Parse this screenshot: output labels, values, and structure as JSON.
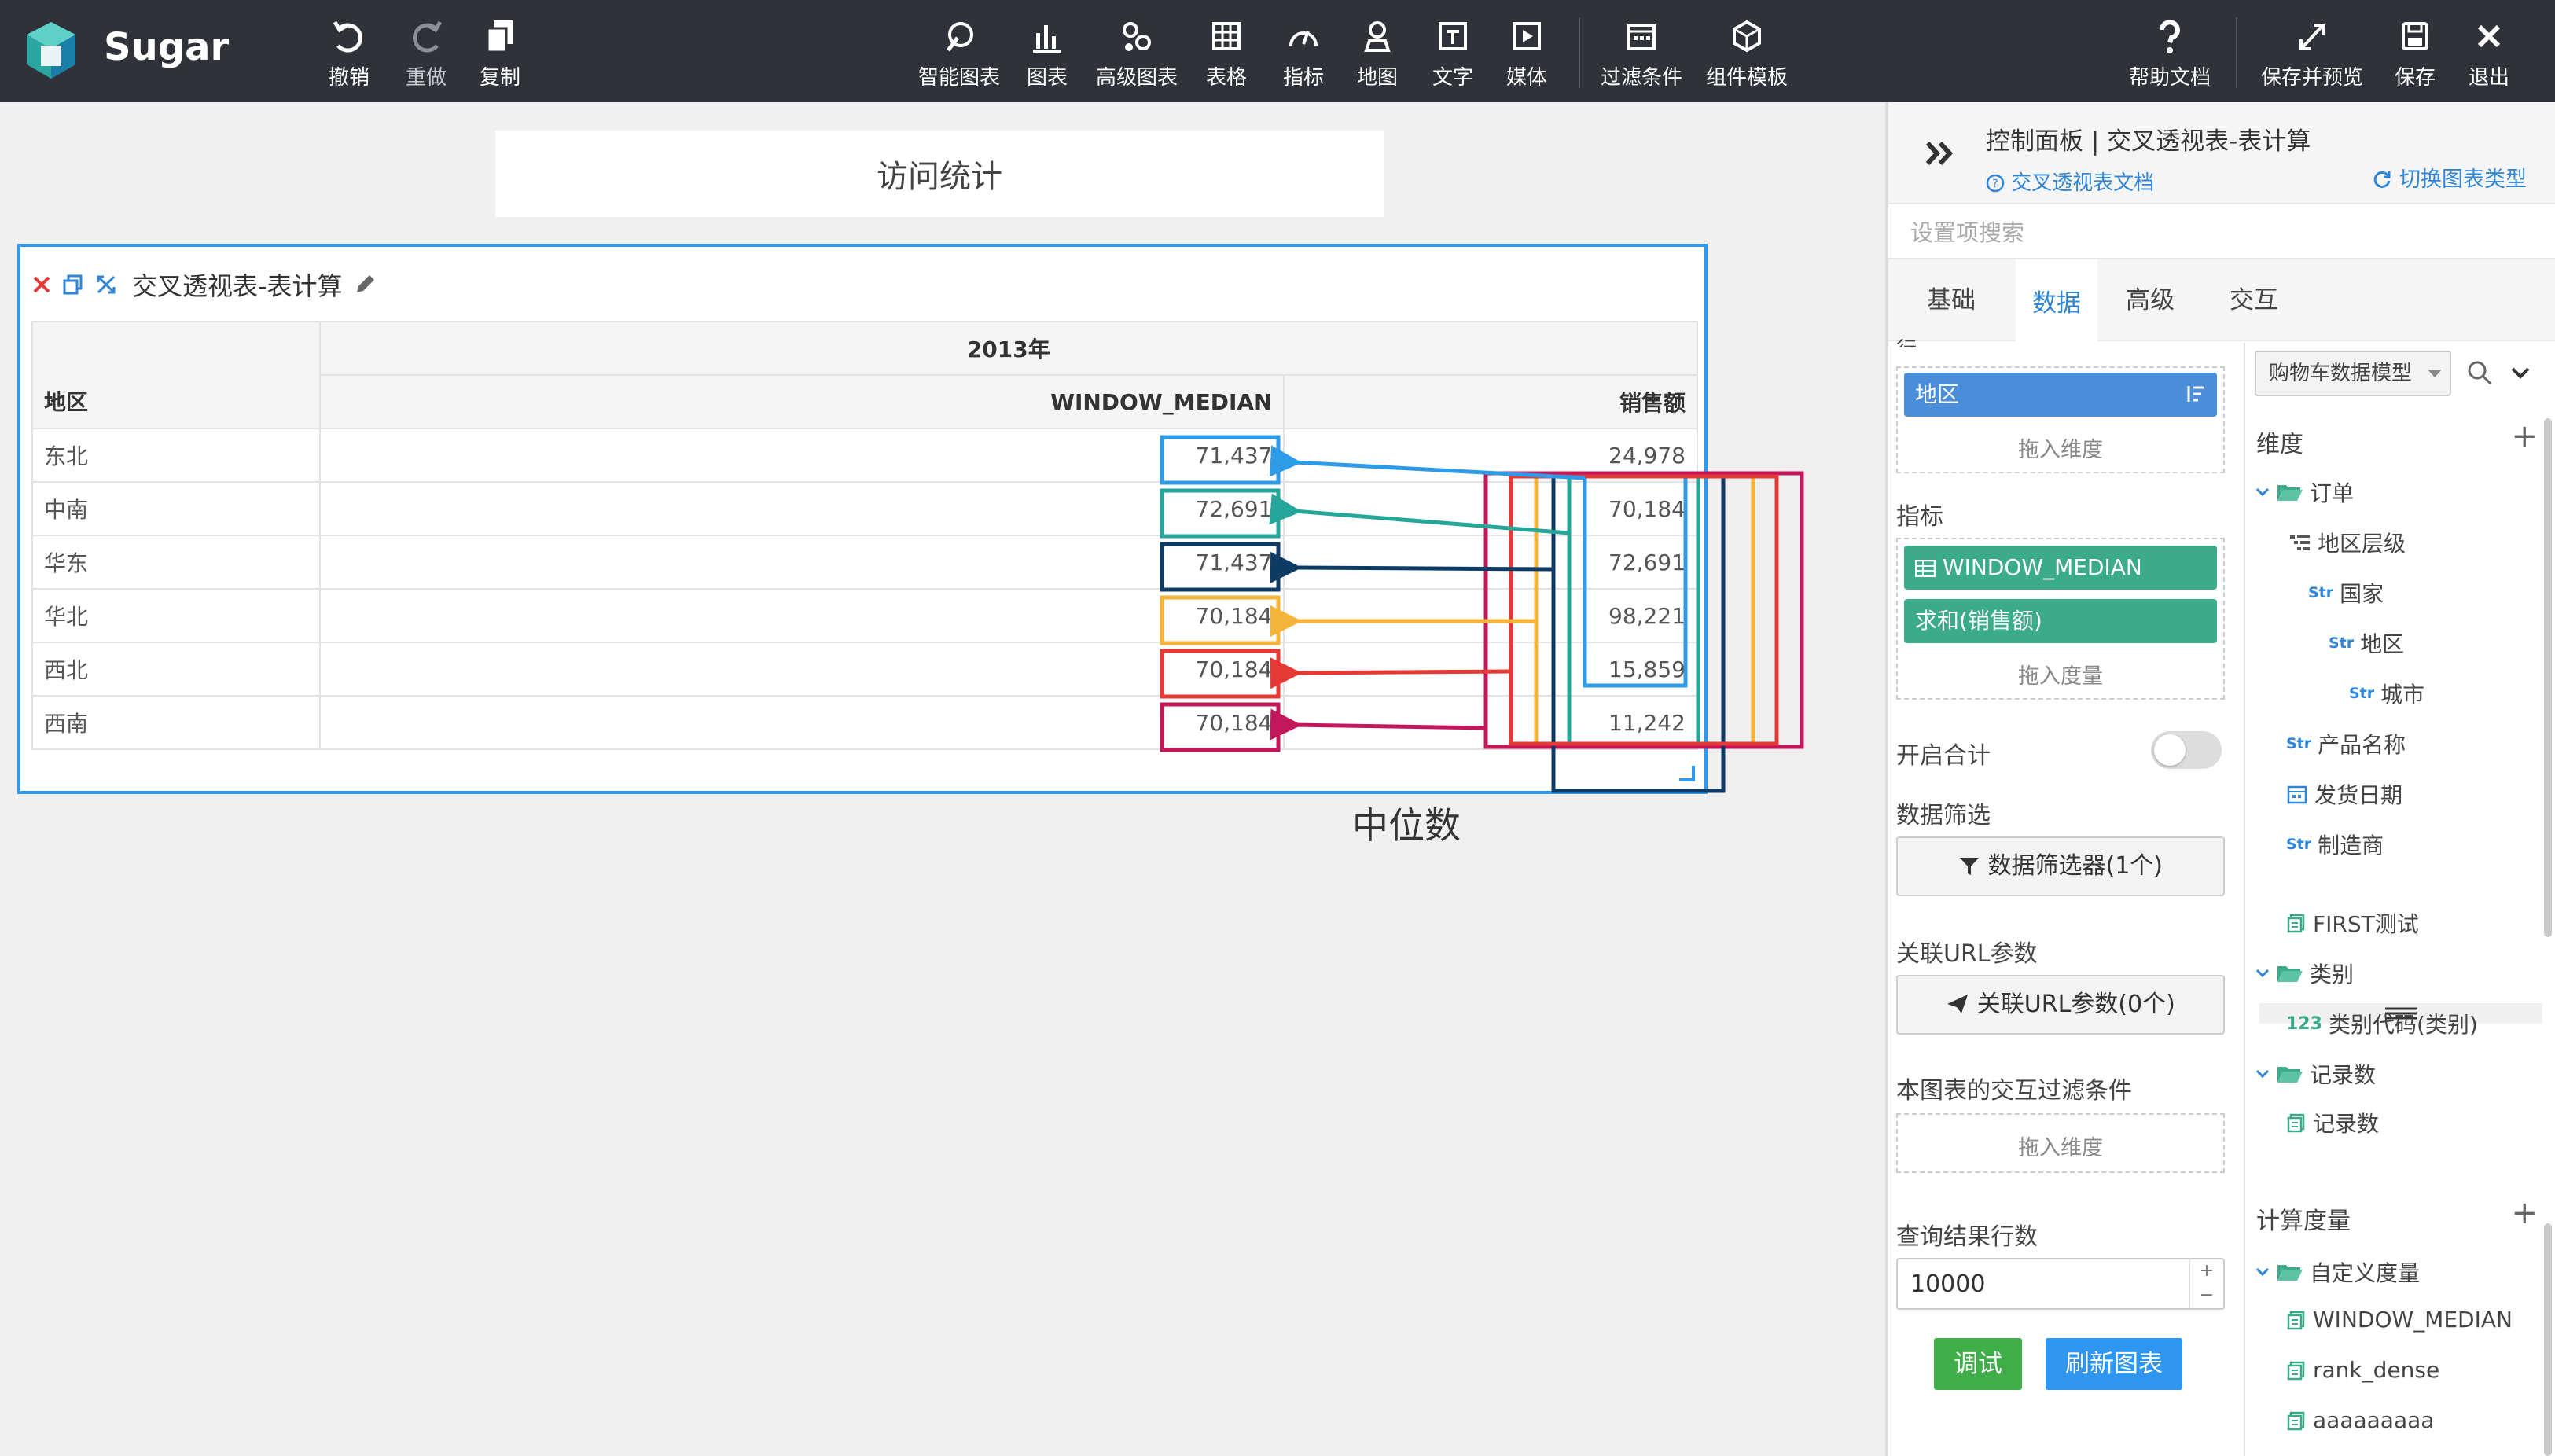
{
  "app": {
    "brand": "Sugar"
  },
  "toolbar": {
    "undo": "撤销",
    "redo": "重做",
    "copy": "复制",
    "smart_chart": "智能图表",
    "chart": "图表",
    "advanced_chart": "高级图表",
    "table": "表格",
    "metric": "指标",
    "map": "地图",
    "text": "文字",
    "media": "媒体",
    "filter": "过滤条件",
    "component_template": "组件模板",
    "help": "帮助文档",
    "save_preview": "保存并预览",
    "save": "保存",
    "exit": "退出"
  },
  "canvas": {
    "page_title": "访问统计",
    "widget_title": "交叉透视表-表计算",
    "annotation": "中位数"
  },
  "pivot": {
    "header_year": "2013年",
    "col_region": "地区",
    "col_median": "WINDOW_MEDIAN",
    "col_sales": "销售额",
    "rows": [
      {
        "region": "东北",
        "median": "71,437",
        "sales": "24,978"
      },
      {
        "region": "中南",
        "median": "72,691",
        "sales": "70,184"
      },
      {
        "region": "华东",
        "median": "71,437",
        "sales": "72,691"
      },
      {
        "region": "华北",
        "median": "70,184",
        "sales": "98,221"
      },
      {
        "region": "西北",
        "median": "70,184",
        "sales": "15,859"
      },
      {
        "region": "西南",
        "median": "70,184",
        "sales": "11,242"
      }
    ]
  },
  "arrow_colors": [
    "#2d9be8",
    "#26a69a",
    "#0d3b66",
    "#f4b43a",
    "#e53935",
    "#c2185b"
  ],
  "panel": {
    "title": "控制面板 | 交叉透视表-表计算",
    "doc_link": "交叉透视表文档",
    "switch_type": "切换图表类型",
    "search_placeholder": "设置项搜索",
    "tabs": [
      "基础",
      "数据",
      "高级",
      "交互"
    ],
    "active_tab": "数据",
    "row_section": "行",
    "row_pill": "地区",
    "drop_dimension": "拖入维度",
    "metric_section": "指标",
    "metric_pills": [
      "WINDOW_MEDIAN",
      "求和(销售额)"
    ],
    "drop_measure": "拖入度量",
    "enable_total": "开启合计",
    "data_filter": "数据筛选",
    "data_filter_btn": "数据筛选器(1个)",
    "url_param": "关联URL参数",
    "url_param_btn": "关联URL参数(0个)",
    "interact_filter": "本图表的交互过滤条件",
    "query_rows": "查询结果行数",
    "query_rows_value": "10000",
    "debug_btn": "调试",
    "refresh_btn": "刷新图表",
    "model": "购物车数据模型",
    "dimension_head": "维度",
    "tree": [
      {
        "label": "订单",
        "kind": "folder"
      },
      {
        "label": "地区层级",
        "kind": "hier"
      },
      {
        "label": "国家",
        "kind": "str"
      },
      {
        "label": "地区",
        "kind": "str"
      },
      {
        "label": "城市",
        "kind": "str"
      },
      {
        "label": "产品名称",
        "kind": "str"
      },
      {
        "label": "发货日期",
        "kind": "date"
      },
      {
        "label": "制造商",
        "kind": "str"
      },
      {
        "label": "FIRST测试",
        "kind": "measure"
      },
      {
        "label": "类别",
        "kind": "folder"
      },
      {
        "label": "类别代码(类别)",
        "kind": "num"
      },
      {
        "label": "记录数",
        "kind": "folder"
      },
      {
        "label": "记录数",
        "kind": "measure"
      }
    ],
    "calc_head": "计算度量",
    "calc_tree": [
      {
        "label": "自定义度量",
        "kind": "folder"
      },
      {
        "label": "WINDOW_MEDIAN",
        "kind": "measure"
      },
      {
        "label": "rank_dense",
        "kind": "measure"
      },
      {
        "label": "aaaaaaaaa",
        "kind": "measure"
      }
    ],
    "str_tag": "Str",
    "num_tag": "123"
  }
}
